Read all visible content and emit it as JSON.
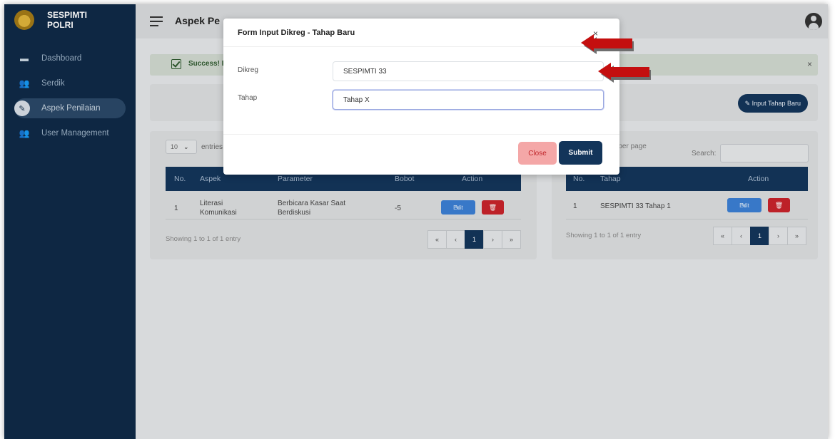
{
  "brand": {
    "line1": "SESPIMTI",
    "line2": "POLRI"
  },
  "sidebar": {
    "items": [
      {
        "label": "Dashboard",
        "icon": "dashboard-icon"
      },
      {
        "label": "Serdik",
        "icon": "users-icon"
      },
      {
        "label": "Aspek Penilaian",
        "icon": "pencil-icon",
        "active": true
      },
      {
        "label": "User Management",
        "icon": "users-icon"
      }
    ]
  },
  "header": {
    "title": "Aspek Pe"
  },
  "alert": {
    "text": "Success! B",
    "close": "×"
  },
  "toolbar": {
    "input_tahap_label": "Input Tahap Baru"
  },
  "left_table": {
    "entries_value": "10",
    "entries_label": "entries",
    "columns": [
      "No.",
      "Aspek",
      "Parameter",
      "Bobot",
      "Action"
    ],
    "rows": [
      {
        "no": "1",
        "aspek": "Literasi Komunikasi",
        "parameter": "Berbicara Kasar Saat Berdiskusi",
        "bobot": "-5",
        "edit": "Edit"
      }
    ],
    "showing": "Showing 1 to 1 of 1 entry",
    "pager": [
      "«",
      "‹",
      "1",
      "›",
      "»"
    ]
  },
  "right_table": {
    "per_page_label": "es per page",
    "search_label": "Search:",
    "columns": [
      "No.",
      "Tahap",
      "Action"
    ],
    "rows": [
      {
        "no": "1",
        "tahap": "SESPIMTI 33 Tahap 1",
        "edit": "Edit"
      }
    ],
    "showing": "Showing 1 to 1 of 1 entry",
    "pager": [
      "«",
      "‹",
      "1",
      "›",
      "»"
    ]
  },
  "modal": {
    "title": "Form Input Dikreg - Tahap Baru",
    "close_x": "×",
    "dikreg_label": "Dikreg",
    "dikreg_value": "SESPIMTI 33",
    "tahap_label": "Tahap",
    "tahap_value": "Tahap X",
    "close_button": "Close",
    "submit_button": "Submit"
  },
  "colors": {
    "navy": "#13355a",
    "sidebar": "#0f2a47",
    "danger": "#c8232b",
    "arrow": "#c40f0f"
  }
}
